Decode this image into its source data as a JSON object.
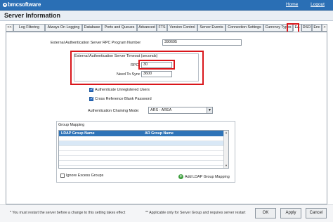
{
  "header": {
    "brand": "bmcsoftware",
    "home_link": "Home",
    "logout_link": "Logout"
  },
  "window": {
    "title": "Server Information"
  },
  "tabs": {
    "prev": "<<",
    "items": [
      "Log Filtering",
      "Always On Logging",
      "Database",
      "Ports and Queues",
      "Advanced",
      "FTS",
      "Version Control",
      "Server Events",
      "Connection Settings",
      "Currency Types",
      "EA",
      "DSO",
      "Enc"
    ],
    "next": ">",
    "active": "EA"
  },
  "form": {
    "rpc_program_label": "External Authentication Server RPC Program Number",
    "rpc_program_value": "390695",
    "timeout_group_label": "External Authentication Server Timeout (seconds)",
    "rpc_label": "RPC",
    "rpc_value": "30",
    "sync_label": "Need To Sync",
    "sync_value": "3600",
    "authenticate_unregistered_label": "Authenticate Unregistered Users",
    "authenticate_unregistered_checked": true,
    "cross_ref_label": "Cross Reference Blank Password",
    "cross_ref_checked": true,
    "chaining_mode_label": "Authentication Chaining Mode:",
    "chaining_mode_value": "ARS - AREA"
  },
  "group_mapping": {
    "title": "Group Mapping",
    "columns": [
      "LDAP Group Name",
      "AR Group Name"
    ],
    "rows": [
      [
        "",
        ""
      ],
      [
        "",
        ""
      ],
      [
        "",
        ""
      ],
      [
        "",
        ""
      ],
      [
        "",
        ""
      ],
      [
        "",
        ""
      ]
    ],
    "ignore_excess_label": "Ignore Excess Groups",
    "ignore_excess_checked": false,
    "add_mapping_label": "Add LDAP Group Mapping"
  },
  "footer": {
    "note_restart": "* You must restart the server before a change to this setting takes effect",
    "note_group": "** Applicable only for Server Group and requires server restart",
    "ok_label": "OK",
    "apply_label": "Apply",
    "cancel_label": "Cancel"
  },
  "colors": {
    "header_blue": "#2a6fb5",
    "grid_header": "#2f74b8",
    "highlight_red": "#d9161b",
    "check_blue": "#2d6fc4"
  }
}
